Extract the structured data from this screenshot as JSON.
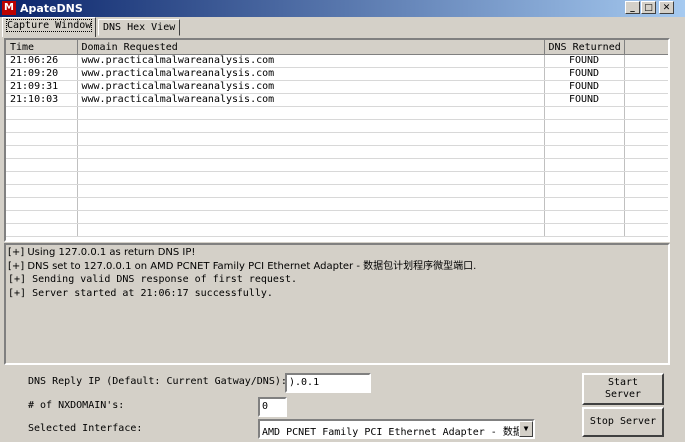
{
  "window": {
    "title": "ApateDNS"
  },
  "tabs": [
    {
      "label": "Capture Window"
    },
    {
      "label": "DNS Hex View"
    }
  ],
  "grid": {
    "columns": [
      "Time",
      "Domain Requested",
      "DNS Returned"
    ],
    "rows": [
      {
        "time": "21:06:26",
        "domain": "www.practicalmalwareanalysis.com",
        "returned": "FOUND"
      },
      {
        "time": "21:09:20",
        "domain": "www.practicalmalwareanalysis.com",
        "returned": "FOUND"
      },
      {
        "time": "21:09:31",
        "domain": "www.practicalmalwareanalysis.com",
        "returned": "FOUND"
      },
      {
        "time": "21:10:03",
        "domain": "www.practicalmalwareanalysis.com",
        "returned": "FOUND"
      }
    ]
  },
  "log": [
    "[+] Using 127.0.0.1 as return DNS IP!",
    "[+] DNS set to 127.0.0.1 on AMD PCNET Family PCI Ethernet Adapter - 数据包计划程序微型端口.",
    "[+] Sending valid DNS response of first request.",
    "[+] Server started at 21:06:17 successfully."
  ],
  "settings": {
    "reply_ip_label": "DNS Reply IP (Default: Current Gatway/DNS):",
    "reply_ip_value": ").0.1",
    "nxdomain_label": "# of NXDOMAIN's:",
    "nxdomain_value": "0",
    "interface_label": "Selected Interface:",
    "interface_value": "AMD PCNET Family PCI Ethernet Adapter - 数据"
  },
  "buttons": {
    "start": "Start Server",
    "stop": "Stop Server"
  }
}
